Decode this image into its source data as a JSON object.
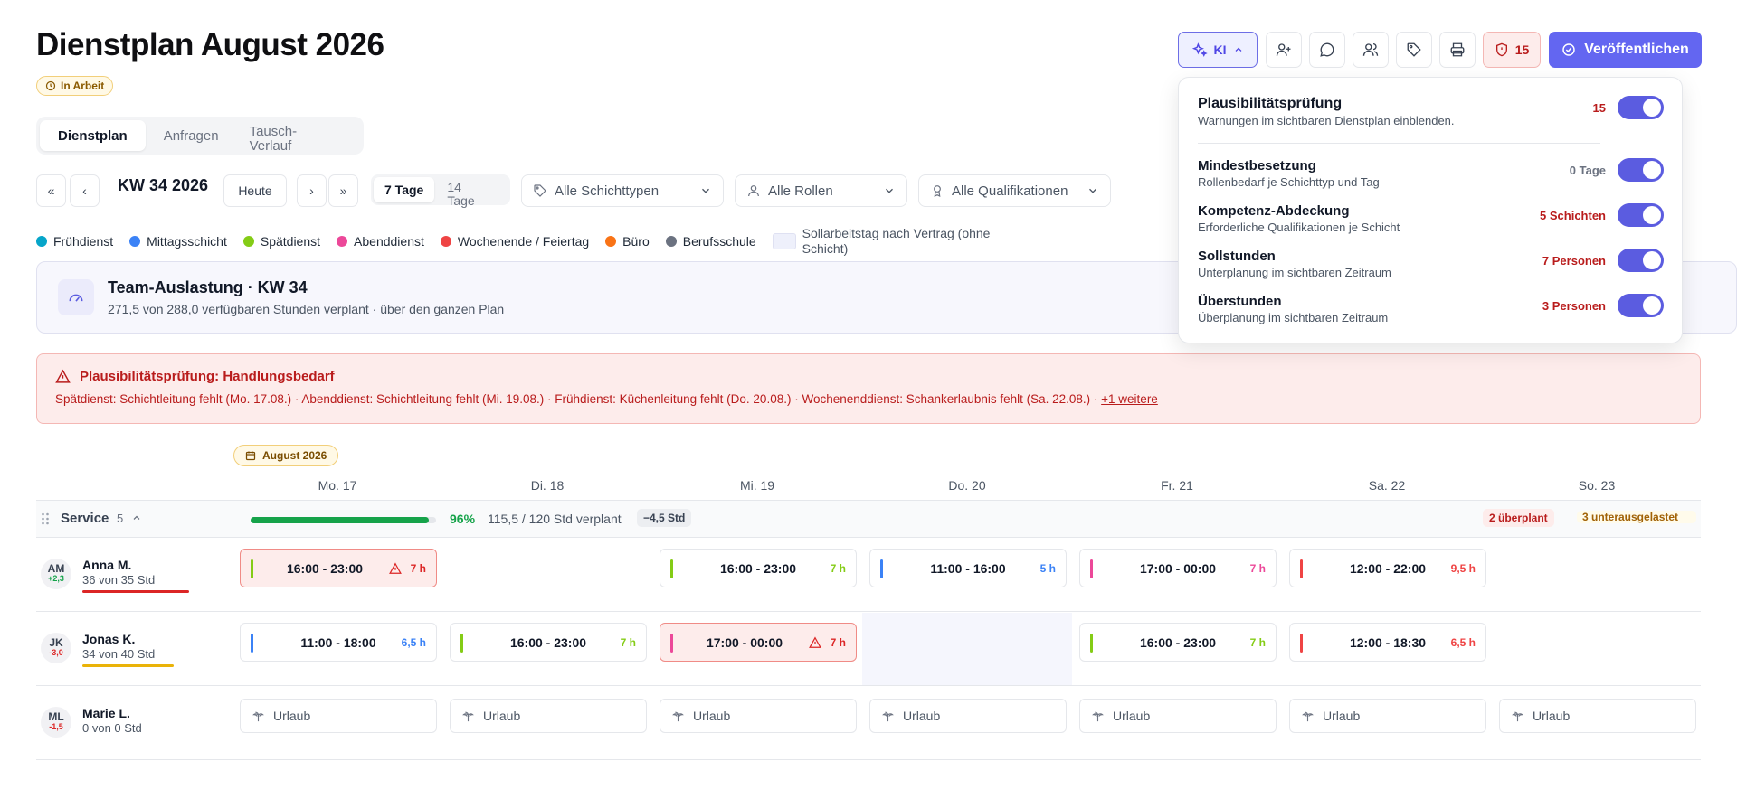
{
  "header": {
    "title": "Dienstplan August 2026",
    "status": "In Arbeit",
    "ki_label": "KI",
    "alert_count": "15",
    "publish_label": "Veröffentlichen"
  },
  "tabs": [
    {
      "label": "Dienstplan"
    },
    {
      "label": "Anfragen"
    },
    {
      "label": "Tausch-Verlauf"
    }
  ],
  "nav": {
    "first": "«",
    "prev": "‹",
    "week": "KW 34 2026",
    "today": "Heute",
    "next": "›",
    "last": "»",
    "view_7": "7 Tage",
    "view_14": "14 Tage"
  },
  "filters": {
    "shift_types": "Alle Schichttypen",
    "roles": "Alle Rollen",
    "qualifications": "Alle Qualifikationen"
  },
  "legend": [
    {
      "label": "Frühdienst",
      "color": "#06a5c9"
    },
    {
      "label": "Mittagsschicht",
      "color": "#3b82f6"
    },
    {
      "label": "Spätdienst",
      "color": "#84cc16"
    },
    {
      "label": "Abenddienst",
      "color": "#ec4899"
    },
    {
      "label": "Wochenende / Feiertag",
      "color": "#ef4444"
    },
    {
      "label": "Büro",
      "color": "#f97316"
    },
    {
      "label": "Berufsschule",
      "color": "#6b7280"
    },
    {
      "label": "Sollarbeitstag nach Vertrag (ohne Schicht)",
      "color": "#eef0fb"
    }
  ],
  "utilization": {
    "title": "Team-Auslastung · KW 34",
    "subtitle": "271,5 von 288,0 verfügbaren Stunden verplant · über den ganzen Plan"
  },
  "warning": {
    "title": "Plausibilitätsprüfung: Handlungsbedarf",
    "text": "Spätdienst: Schichtleitung fehlt (Mo. 17.08.) · Abenddienst: Schichtleitung fehlt (Mi. 19.08.) · Frühdienst: Küchenleitung fehlt (Do. 20.08.) · Wochenenddienst: Schankerlaubnis fehlt (Sa. 22.08.) · ",
    "more": "+1 weitere"
  },
  "schedule": {
    "month": "August 2026",
    "days": [
      "Mo. 17",
      "Di. 18",
      "Mi. 19",
      "Do. 20",
      "Fr. 21",
      "Sa. 22",
      "So. 23"
    ],
    "group": {
      "name": "Service",
      "count": "5",
      "percent": "96%",
      "percent_value": 96,
      "hours": "115,5 / 120 Std verplant",
      "delta": "−4,5 Std",
      "overplanned": "2 überplant",
      "underused": "3 unterausgelastet"
    },
    "employees": [
      {
        "initials": "AM",
        "delta": "+2,3",
        "name": "Anna M.",
        "hours": "36 von 35 Std",
        "bar_color": "#dc2626",
        "shifts": [
          {
            "time": "16:00 - 23:00",
            "dur": "7 h",
            "color": "#84cc16",
            "alert": true
          },
          null,
          {
            "time": "16:00 - 23:00",
            "dur": "7 h",
            "color": "#84cc16",
            "alert": false
          },
          {
            "time": "11:00 - 16:00",
            "dur": "5 h",
            "color": "#3b82f6",
            "alert": false
          },
          {
            "time": "17:00 - 00:00",
            "dur": "7 h",
            "color": "#ec4899",
            "alert": false
          },
          {
            "time": "12:00 - 22:00",
            "dur": "9,5 h",
            "color": "#ef4444",
            "alert": false
          },
          null
        ]
      },
      {
        "initials": "JK",
        "delta": "-3,0",
        "name": "Jonas K.",
        "hours": "34 von 40 Std",
        "bar_color": "#eab308",
        "shifts": [
          {
            "time": "11:00 - 18:00",
            "dur": "6,5 h",
            "color": "#3b82f6",
            "alert": false
          },
          {
            "time": "16:00 - 23:00",
            "dur": "7 h",
            "color": "#84cc16",
            "alert": false
          },
          {
            "time": "17:00 - 00:00",
            "dur": "7 h",
            "color": "#ec4899",
            "alert": true
          },
          null,
          {
            "time": "16:00 - 23:00",
            "dur": "7 h",
            "color": "#84cc16",
            "alert": false
          },
          {
            "time": "12:00 - 18:30",
            "dur": "6,5 h",
            "color": "#ef4444",
            "alert": false
          },
          null
        ]
      },
      {
        "initials": "ML",
        "delta": "-1,5",
        "name": "Marie L.",
        "hours": "0 von 0 Std",
        "vacation": "Urlaub"
      }
    ]
  },
  "popover": {
    "title": "Plausibilitätsprüfung",
    "subtitle": "Warnungen im sichtbaren Dienstplan einblenden.",
    "value": "15",
    "items": [
      {
        "title": "Mindestbesetzung",
        "subtitle": "Rollenbedarf je Schichttyp und Tag",
        "value": "0 Tage"
      },
      {
        "title": "Kompetenz-Abdeckung",
        "subtitle": "Erforderliche Qualifikationen je Schicht",
        "value": "5 Schichten"
      },
      {
        "title": "Sollstunden",
        "subtitle": "Unterplanung im sichtbaren Zeitraum",
        "value": "7 Personen"
      },
      {
        "title": "Überstunden",
        "subtitle": "Überplanung im sichtbaren Zeitraum",
        "value": "3 Personen"
      }
    ]
  }
}
